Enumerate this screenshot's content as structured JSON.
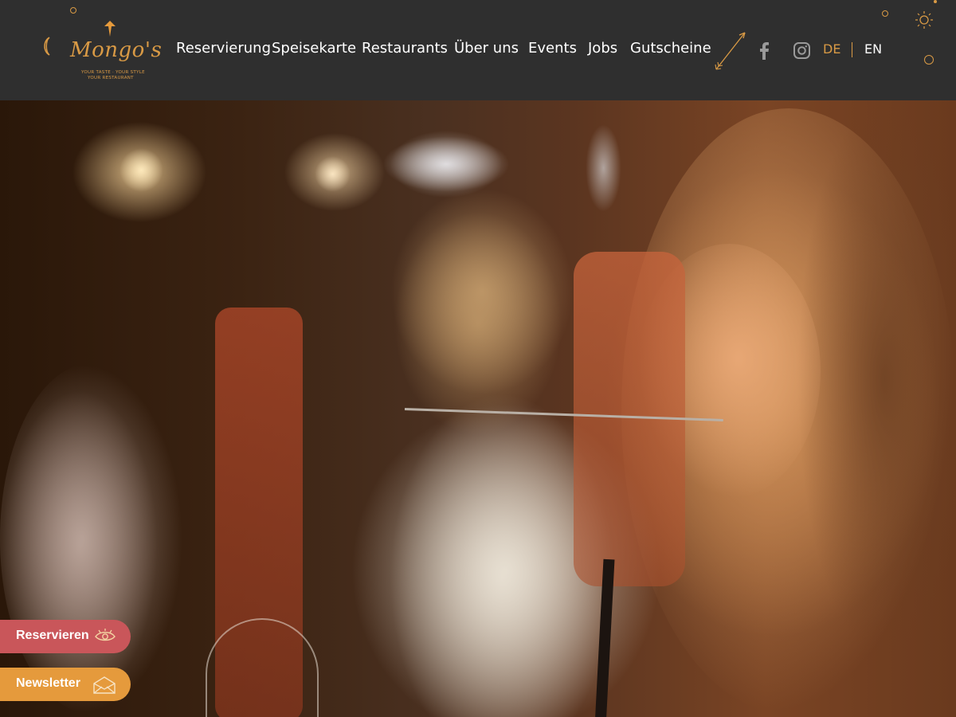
{
  "brand": {
    "name": "Mongo's",
    "tagline_line1": "YOUR TASTE · YOUR STYLE",
    "tagline_line2": "YOUR RESTAURANT"
  },
  "nav": {
    "items": [
      {
        "label": "Reservierung"
      },
      {
        "label": "Speisekarte"
      },
      {
        "label": "Restaurants"
      },
      {
        "label": "Über uns"
      },
      {
        "label": "Events"
      },
      {
        "label": "Jobs"
      },
      {
        "label": "Gutscheine"
      }
    ]
  },
  "social": {
    "icons": [
      "arrow-icon",
      "facebook-icon",
      "instagram-icon"
    ]
  },
  "languages": {
    "active": "DE",
    "inactive": "EN"
  },
  "hero": {
    "image": "woman-eating-in-restaurant-photo"
  },
  "floating": {
    "reserve_label": "Reservieren",
    "newsletter_label": "Newsletter"
  },
  "colors": {
    "header_bg": "#2f2f2f",
    "accent_gold": "#d99a45",
    "reserve_btn": "#c9565a",
    "newsletter_btn": "#e59a3c",
    "nav_text": "#ffffff"
  }
}
